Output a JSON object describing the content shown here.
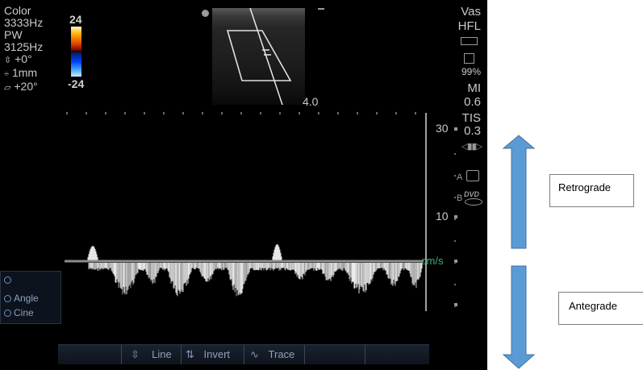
{
  "left_info": {
    "mode": "Color",
    "color_freq": "3333Hz",
    "doppler_mode": "PW",
    "pw_freq": "3125Hz",
    "angle": "+0°",
    "gate": "1mm",
    "steer": "+20°"
  },
  "color_bar": {
    "max": "24",
    "min": "-24"
  },
  "depth_label": "4.0",
  "right_info": {
    "preset_top": "Vas",
    "preset_bottom": "HFL",
    "percent": "99%",
    "mi_label": "MI",
    "mi_value": "0.6",
    "tis_label": "TIS",
    "tis_value": "0.3",
    "label_a": "A",
    "label_b": "B",
    "dvd": "DVD"
  },
  "scale": {
    "top": "30",
    "mid": "10",
    "unit": "cm/s"
  },
  "left_panel": {
    "angle": "Angle",
    "cine": "Cine"
  },
  "bottom_bar": {
    "line": "Line",
    "invert": "Invert",
    "trace": "Trace"
  },
  "annotations": {
    "retrograde": "Retrograde",
    "antegrade": "Antegrade"
  },
  "colors": {
    "arrow": "#5b9bd5",
    "arrow_border": "#41719c",
    "baseline": "#8c8c8c",
    "scale_text": "#3cb371"
  }
}
